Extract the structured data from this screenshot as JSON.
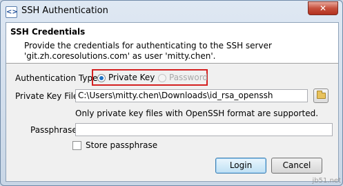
{
  "window": {
    "title": "SSH Authentication",
    "icon": "app-icon",
    "close_glyph": "✕"
  },
  "header": {
    "title": "SSH Credentials",
    "description": "Provide the credentials for authenticating to the SSH server 'git.zh.coresolutions.com' as user 'mitty.chen'."
  },
  "auth": {
    "label": "Authentication Type:",
    "options": [
      {
        "label": "Private Key",
        "selected": true,
        "enabled": true
      },
      {
        "label": "Password",
        "selected": false,
        "enabled": false
      }
    ]
  },
  "key_file": {
    "label": "Private Key File:",
    "value": "C:\\Users\\mitty.chen\\Downloads\\id_rsa_openssh",
    "note": "Only private key files with OpenSSH format are supported.",
    "browse_icon": "folder-icon"
  },
  "passphrase": {
    "label": "Passphrase:",
    "value": ""
  },
  "store": {
    "label": "Store passphrase",
    "checked": false
  },
  "buttons": {
    "login": "Login",
    "cancel": "Cancel"
  },
  "watermark": "jb51.net",
  "colors": {
    "highlight": "#d42020",
    "accent": "#1e73c6"
  }
}
